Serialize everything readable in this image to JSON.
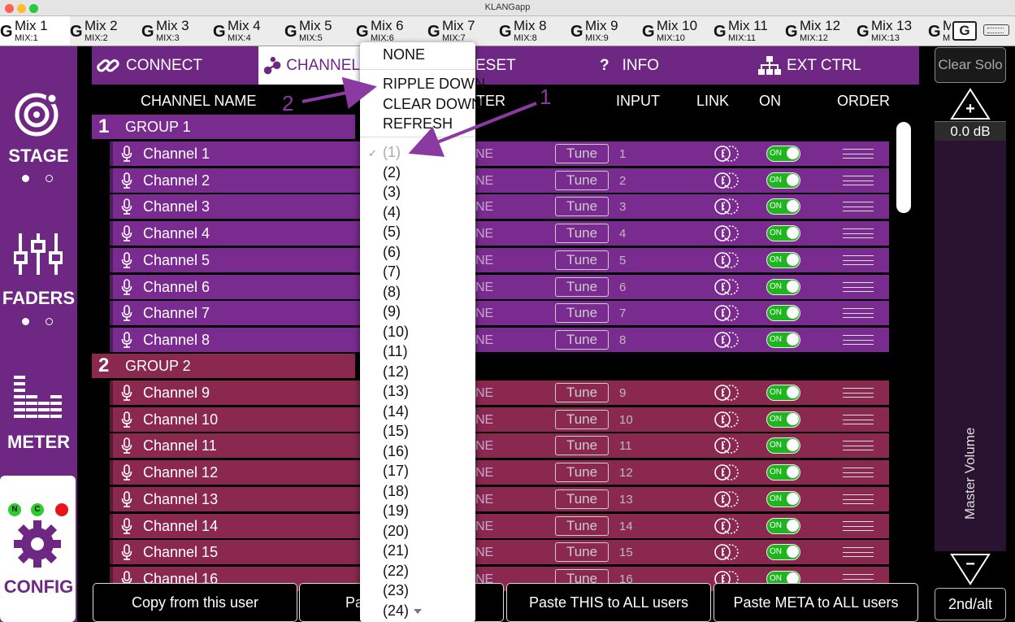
{
  "window": {
    "title": "KLANGapp"
  },
  "mix_tabs": [
    {
      "name": "Mix 1",
      "sub": "MIX:1",
      "active": true
    },
    {
      "name": "Mix 2",
      "sub": "MIX:2"
    },
    {
      "name": "Mix 3",
      "sub": "MIX:3"
    },
    {
      "name": "Mix 4",
      "sub": "MIX:4"
    },
    {
      "name": "Mix 5",
      "sub": "MIX:5"
    },
    {
      "name": "Mix 6",
      "sub": "MIX:6"
    },
    {
      "name": "Mix 7",
      "sub": "MIX:7"
    },
    {
      "name": "Mix 8",
      "sub": "MIX:8"
    },
    {
      "name": "Mix 9",
      "sub": "MIX:9"
    },
    {
      "name": "Mix 10",
      "sub": "MIX:10"
    },
    {
      "name": "Mix 11",
      "sub": "MIX:11"
    },
    {
      "name": "Mix 12",
      "sub": "MIX:12"
    },
    {
      "name": "Mix 13",
      "sub": "MIX:13"
    },
    {
      "name": "M",
      "sub": "M"
    }
  ],
  "mix_tab_logo": "G",
  "tab_end_logo": "G",
  "sidebar": {
    "stage": "STAGE",
    "faders": "FADERS",
    "meter": "METER",
    "config": "CONFIG",
    "leds": [
      {
        "label": "N",
        "color": "#2ecc2e"
      },
      {
        "label": "C",
        "color": "#2ecc2e"
      },
      {
        "label": "",
        "color": "#e8141a"
      }
    ]
  },
  "nav": {
    "connect": "CONNECT",
    "channel": "CHANNEL",
    "preset": "ESET",
    "info_mark": "?",
    "info": "INFO",
    "ext_ctrl": "EXT CTRL"
  },
  "clear_solo": "Clear Solo",
  "columns": {
    "channel_name": "CHANNEL NAME",
    "filter": "TER",
    "input": "INPUT",
    "link": "LINK",
    "on": "ON",
    "order": "ORDER"
  },
  "groups": [
    {
      "num": "1",
      "name": "GROUP 1",
      "color": "#7a2b8f"
    },
    {
      "num": "2",
      "name": "GROUP 2",
      "color": "#8a2850"
    }
  ],
  "channels": [
    {
      "name": "Channel 1",
      "ne": "NE",
      "tune": "Tune",
      "input": "1",
      "on": "ON"
    },
    {
      "name": "Channel 2",
      "ne": "NE",
      "tune": "Tune",
      "input": "2",
      "on": "ON"
    },
    {
      "name": "Channel 3",
      "ne": "NE",
      "tune": "Tune",
      "input": "3",
      "on": "ON"
    },
    {
      "name": "Channel 4",
      "ne": "NE",
      "tune": "Tune",
      "input": "4",
      "on": "ON"
    },
    {
      "name": "Channel 5",
      "ne": "NE",
      "tune": "Tune",
      "input": "5",
      "on": "ON"
    },
    {
      "name": "Channel 6",
      "ne": "NE",
      "tune": "Tune",
      "input": "6",
      "on": "ON"
    },
    {
      "name": "Channel 7",
      "ne": "NE",
      "tune": "Tune",
      "input": "7",
      "on": "ON"
    },
    {
      "name": "Channel 8",
      "ne": "NE",
      "tune": "Tune",
      "input": "8",
      "on": "ON"
    },
    {
      "name": "Channel 9",
      "ne": "NE",
      "tune": "Tune",
      "input": "9",
      "on": "ON"
    },
    {
      "name": "Channel 10",
      "ne": "NE",
      "tune": "Tune",
      "input": "10",
      "on": "ON"
    },
    {
      "name": "Channel 11",
      "ne": "NE",
      "tune": "Tune",
      "input": "11",
      "on": "ON"
    },
    {
      "name": "Channel 12",
      "ne": "NE",
      "tune": "Tune",
      "input": "12",
      "on": "ON"
    },
    {
      "name": "Channel 13",
      "ne": "NE",
      "tune": "Tune",
      "input": "13",
      "on": "ON"
    },
    {
      "name": "Channel 14",
      "ne": "NE",
      "tune": "Tune",
      "input": "14",
      "on": "ON"
    },
    {
      "name": "Channel 15",
      "ne": "NE",
      "tune": "Tune",
      "input": "15",
      "on": "ON"
    },
    {
      "name": "Channel 16",
      "ne": "NE",
      "tune": "Tune",
      "input": "16",
      "on": "ON"
    }
  ],
  "master": {
    "db": "0.0 dB",
    "label": "Master Volume",
    "up": "+",
    "down": "−"
  },
  "second_alt": "2nd/alt",
  "bottom_buttons": {
    "copy": "Copy from this user",
    "paste_partial": "Pa",
    "paste_all": "Paste THIS to ALL users",
    "paste_meta": "Paste META to ALL users"
  },
  "menu": {
    "none": "NONE",
    "ripple": "RIPPLE DOWN",
    "clear": "CLEAR DOWN",
    "refresh": "REFRESH",
    "check": "✓",
    "items": [
      "(1)",
      "(2)",
      "(3)",
      "(4)",
      "(5)",
      "(6)",
      "(7)",
      "(8)",
      "(9)",
      "(10)",
      "(11)",
      "(12)",
      "(13)",
      "(14)",
      "(15)",
      "(16)",
      "(17)",
      "(18)",
      "(19)",
      "(20)",
      "(21)",
      "(22)",
      "(23)",
      "(24)"
    ]
  },
  "annotations": {
    "one": "1",
    "two": "2",
    "color": "#8a3aa1"
  },
  "colors": {
    "purple": "#6f2784",
    "group1_row": "#7a2b8f",
    "group2_row": "#8a2850",
    "toggle_on": "#1fb51f"
  }
}
